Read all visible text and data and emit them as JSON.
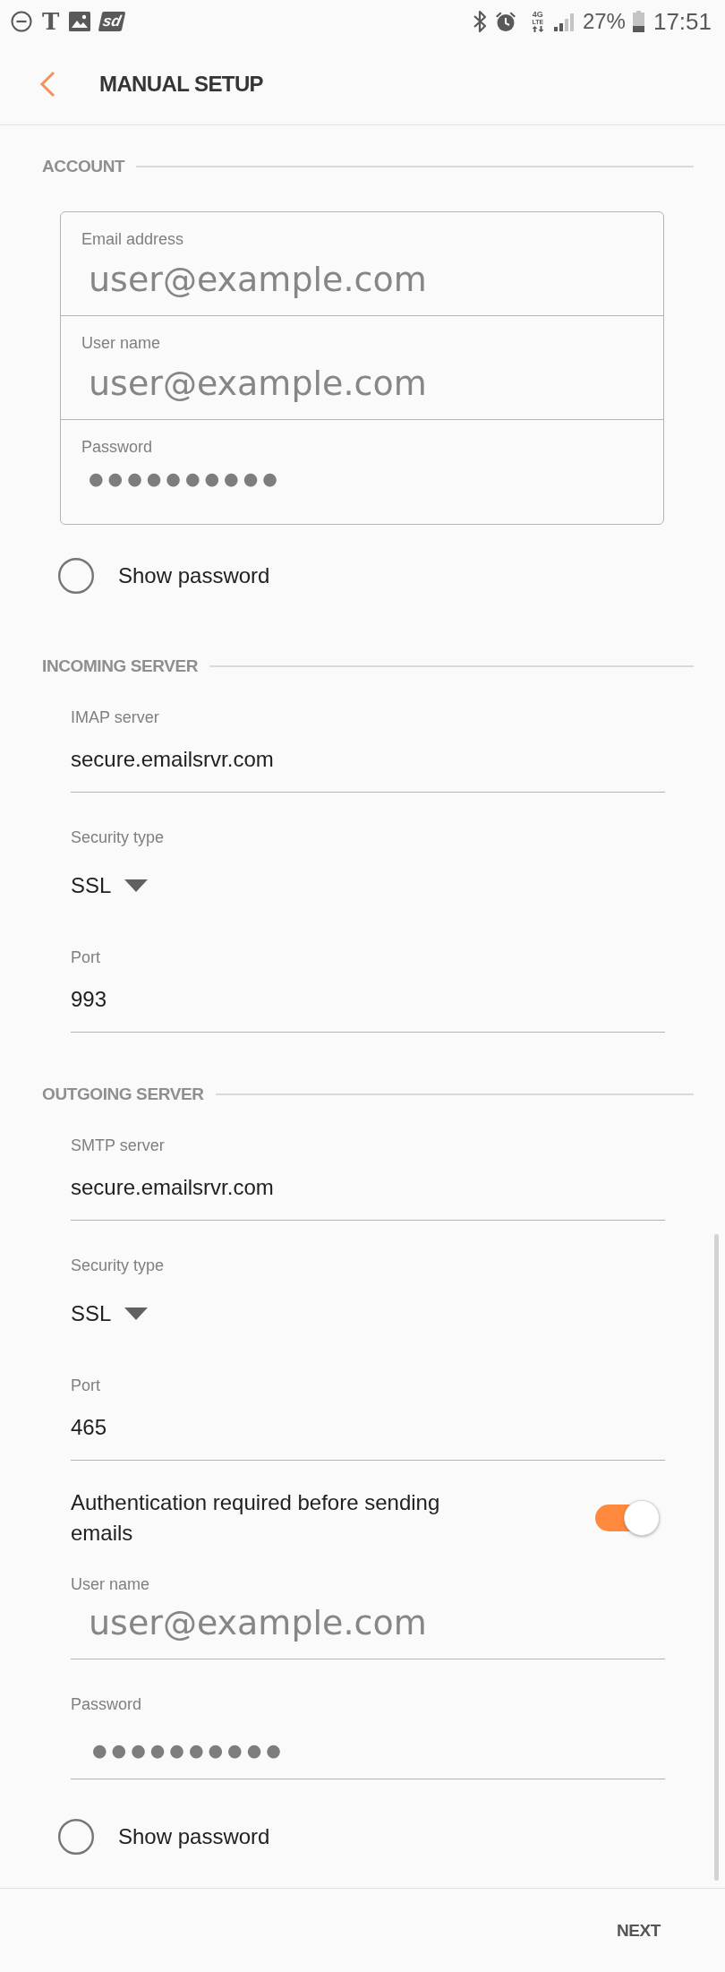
{
  "status_bar": {
    "carrier_logo": "T",
    "app_badge": "sd",
    "network_type": "4G",
    "network_tech": "LTE",
    "battery_percent": "27%",
    "time": "17:51"
  },
  "app_bar": {
    "title": "MANUAL SETUP"
  },
  "sections": [
    {
      "title": "ACCOUNT",
      "kind": "boxed",
      "fields": [
        {
          "kind": "credential",
          "label": "Email address",
          "value": "user@example.com"
        },
        {
          "kind": "credential",
          "label": "User name",
          "value": "user@example.com"
        },
        {
          "kind": "password",
          "label": "Password",
          "value": "●●●●●●●●●●"
        }
      ],
      "show_password": {
        "label": "Show password",
        "checked": false
      }
    },
    {
      "title": "INCOMING SERVER",
      "kind": "underlined",
      "fields": [
        {
          "kind": "text",
          "label": "IMAP server",
          "value": "secure.emailsrvr.com"
        },
        {
          "kind": "dropdown",
          "label": "Security type",
          "value": "SSL"
        },
        {
          "kind": "text",
          "label": "Port",
          "value": "993"
        }
      ]
    },
    {
      "title": "OUTGOING SERVER",
      "kind": "underlined",
      "fields": [
        {
          "kind": "text",
          "label": "SMTP server",
          "value": "secure.emailsrvr.com"
        },
        {
          "kind": "dropdown",
          "label": "Security type",
          "value": "SSL"
        },
        {
          "kind": "text",
          "label": "Port",
          "value": "465"
        },
        {
          "kind": "switch",
          "label": "Authentication required before sending emails",
          "on": true
        },
        {
          "kind": "credential",
          "label": "User name",
          "value": "user@example.com"
        },
        {
          "kind": "password",
          "label": "Password",
          "value": "●●●●●●●●●●"
        }
      ],
      "show_password": {
        "label": "Show password",
        "checked": false
      }
    }
  ],
  "footer": {
    "next_button": "NEXT"
  }
}
